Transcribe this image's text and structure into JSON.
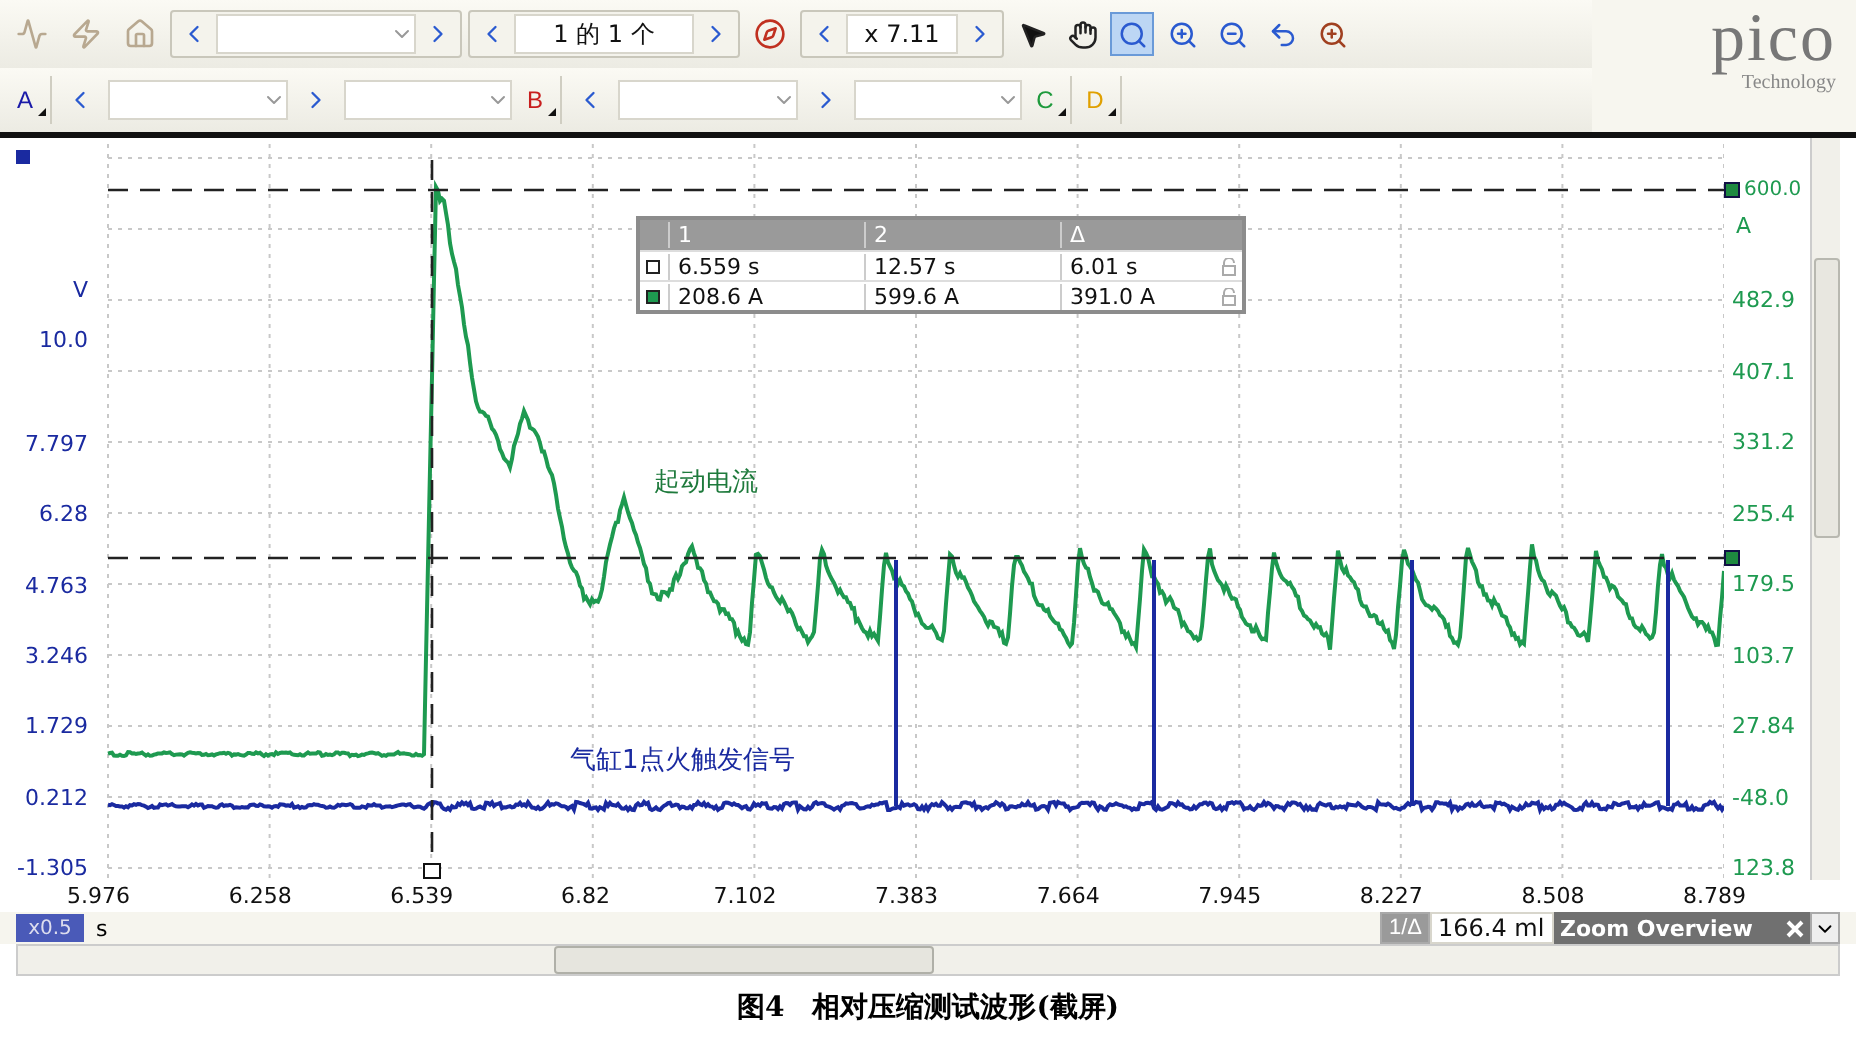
{
  "toolbar": {
    "page_label": "1 的 1 个",
    "zoom_value": "x 7.11",
    "tools": [
      {
        "kind": "pointer",
        "selected": false
      },
      {
        "kind": "hand",
        "selected": false
      },
      {
        "kind": "zoom-box",
        "selected": true
      },
      {
        "kind": "zoom-in",
        "selected": false
      },
      {
        "kind": "zoom-out",
        "selected": false
      },
      {
        "kind": "undo",
        "selected": false
      },
      {
        "kind": "zoom-fit",
        "selected": false
      }
    ]
  },
  "logo": {
    "name": "pico",
    "tagline": "Technology"
  },
  "channels": [
    {
      "label": "A",
      "color": "#1a1aa8"
    },
    {
      "label": "B",
      "color": "#c81e1e"
    },
    {
      "label": "C",
      "color": "#1e9a3c"
    },
    {
      "label": "D",
      "color": "#e0a000"
    }
  ],
  "left_axis": {
    "unit": "V",
    "top_value": "10.0",
    "ticks": [
      "7.797",
      "6.28",
      "4.763",
      "3.246",
      "1.729",
      "0.212",
      "-1.305"
    ]
  },
  "right_axis": {
    "top_value": "600.0",
    "unit": "A",
    "ticks": [
      "482.9",
      "407.1",
      "331.2",
      "255.4",
      "179.5",
      "103.7",
      "27.84",
      "-48.0",
      "123.8"
    ]
  },
  "x_axis": {
    "unit": "s",
    "multiplier": "x0.5",
    "ticks": [
      "5.976",
      "6.258",
      "6.539",
      "6.82",
      "7.102",
      "7.383",
      "7.664",
      "7.945",
      "8.227",
      "8.508",
      "8.789"
    ]
  },
  "measurements": {
    "columns": [
      "1",
      "2",
      "Δ"
    ],
    "rows": [
      {
        "color": "#ffffff",
        "values": [
          "6.559 s",
          "12.57 s",
          "6.01 s"
        ]
      },
      {
        "color": "#1e9a50",
        "values": [
          "208.6 A",
          "599.6 A",
          "391.0 A"
        ]
      }
    ]
  },
  "annotations": [
    {
      "text": "起动电流",
      "color": "#1e7a3c"
    },
    {
      "text": "气缸1点火触发信号",
      "color": "#1a2aa0"
    }
  ],
  "bottom": {
    "ruler_button": "1/Δ",
    "ruler_value": "166.4 ml",
    "zoom_overview": "Zoom Overview"
  },
  "caption": "图4　相对压缩测试波形(截屏)"
}
